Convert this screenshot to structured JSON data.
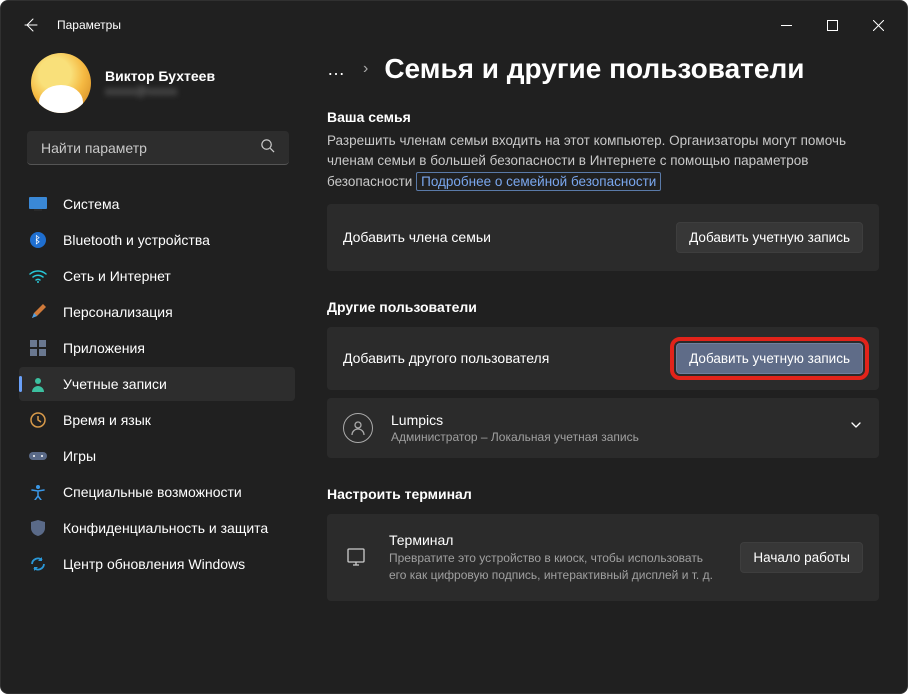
{
  "window_title": "Параметры",
  "profile": {
    "name": "Виктор Бухтеев",
    "email": "xxxxx@xxxxx"
  },
  "search": {
    "placeholder": "Найти параметр"
  },
  "nav": {
    "system": "Система",
    "bluetooth": "Bluetooth и устройства",
    "network": "Сеть и Интернет",
    "personalization": "Персонализация",
    "apps": "Приложения",
    "accounts": "Учетные записи",
    "time": "Время и язык",
    "games": "Игры",
    "accessibility": "Специальные возможности",
    "privacy": "Конфиденциальность и защита",
    "update": "Центр обновления Windows"
  },
  "crumb": {
    "ellipsis": "…",
    "sep": "›"
  },
  "page_title": "Семья и другие пользователи",
  "family": {
    "heading": "Ваша семья",
    "desc_pre": "Разрешить членам семьи входить на этот компьютер. Организаторы могут помочь членам семьи в большей безопасности в Интернете с помощью параметров безопасности ",
    "link": "Подробнее о семейной безопасности",
    "add_label": "Добавить члена семьи",
    "add_btn": "Добавить учетную запись"
  },
  "others": {
    "heading": "Другие пользователи",
    "add_label": "Добавить другого пользователя",
    "add_btn": "Добавить учетную запись",
    "user_name": "Lumpics",
    "user_role": "Администратор – Локальная учетная запись"
  },
  "terminal": {
    "heading": "Настроить терминал",
    "title": "Терминал",
    "desc": "Превратите это устройство в киоск, чтобы использовать его как цифровую подпись, интерактивный дисплей и т. д.",
    "btn": "Начало работы"
  }
}
